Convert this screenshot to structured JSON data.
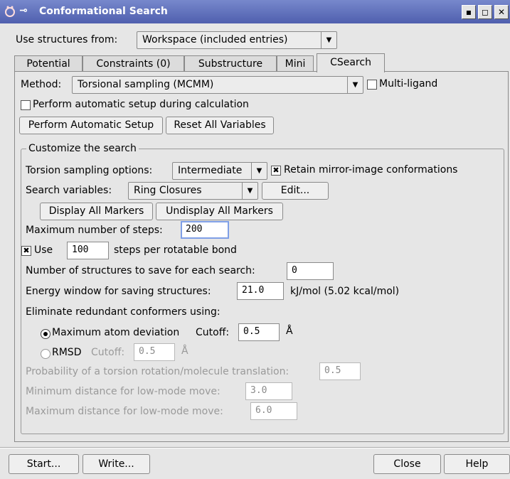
{
  "window": {
    "title": "Conformational Search",
    "buttons": [
      "▪",
      "◻",
      "✕"
    ]
  },
  "use_structures": {
    "label": "Use structures from:",
    "value": "Workspace (included entries)"
  },
  "tabs": [
    {
      "label": "Potential"
    },
    {
      "label": "Constraints (0)"
    },
    {
      "label": "Substructure"
    },
    {
      "label": "Mini"
    },
    {
      "label": "CSearch"
    }
  ],
  "method": {
    "label": "Method:",
    "value": "Torsional sampling (MCMM)",
    "multi_ligand_label": "Multi-ligand"
  },
  "auto_setup": {
    "checkbox_label": "Perform automatic setup during calculation",
    "perform_button": "Perform Automatic Setup",
    "reset_button": "Reset All Variables"
  },
  "customize": {
    "title": "Customize the search",
    "torsion_label": "Torsion sampling options:",
    "torsion_value": "Intermediate",
    "retain_label": "Retain mirror-image conformations",
    "search_vars_label": "Search variables:",
    "search_vars_value": "Ring Closures",
    "edit_button": "Edit...",
    "display_markers": "Display All Markers",
    "undisplay_markers": "Undisplay All Markers",
    "max_steps_label": "Maximum number of steps:",
    "max_steps_value": "200",
    "use_label": "Use",
    "use_value": "100",
    "steps_per_bond_label": "steps per rotatable bond",
    "num_structures_label": "Number of structures to save for each search:",
    "num_structures_value": "0",
    "energy_label": "Energy window for saving structures:",
    "energy_value": "21.0",
    "energy_units": "kJ/mol  (5.02 kcal/mol)",
    "eliminate_label": "Eliminate redundant conformers using:",
    "max_atom_dev_label": "Maximum atom deviation",
    "cutoff_label": "Cutoff:",
    "cutoff_value": "0.5",
    "angstrom": "Å",
    "rmsd_label": "RMSD",
    "rmsd_cutoff_label": "Cutoff:",
    "rmsd_cutoff_value": "0.5",
    "prob_label": "Probability of a torsion rotation/molecule translation:",
    "prob_value": "0.5",
    "min_dist_label": "Minimum distance for low-mode move:",
    "min_dist_value": "3.0",
    "max_dist_label": "Maximum distance for low-mode move:",
    "max_dist_value": "6.0"
  },
  "footer": {
    "start": "Start...",
    "write": "Write...",
    "close": "Close",
    "help": "Help"
  },
  "checkbox_mark": "✖",
  "dropdown_arrow": "▼"
}
